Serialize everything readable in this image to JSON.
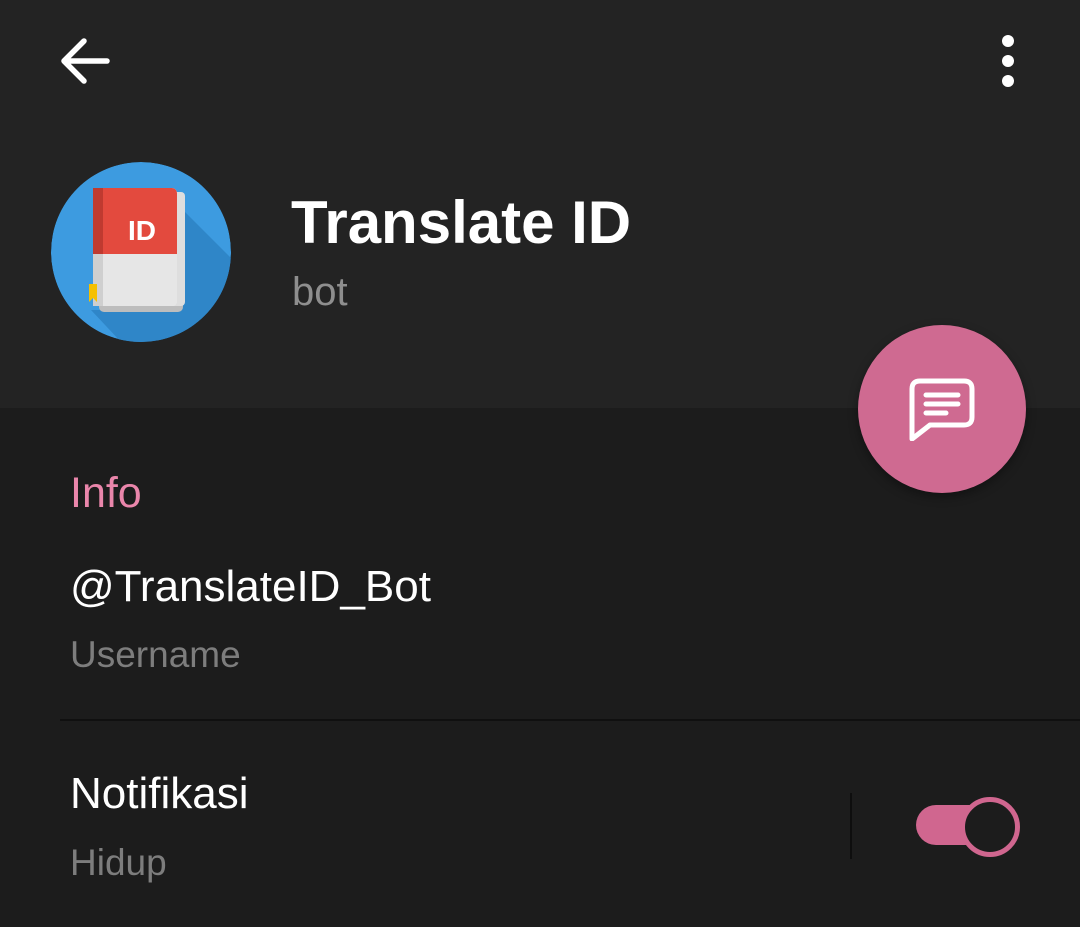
{
  "header": {
    "back_icon": "arrow-left-icon",
    "menu_icon": "more-vertical-icon",
    "title": "Translate ID",
    "subtitle": "bot",
    "avatar_icon": "book-icon",
    "avatar_badge": "ID"
  },
  "fab": {
    "icon": "message-icon"
  },
  "info": {
    "section_title": "Info",
    "username_value": "@TranslateID_Bot",
    "username_label": "Username",
    "notification_label": "Notifikasi",
    "notification_value": "Hidup",
    "notification_enabled": true
  },
  "colors": {
    "accent": "#cf6a91",
    "section_title": "#ea86ab",
    "background": "#1c1c1c",
    "header_background": "#232323",
    "avatar_background": "#3d9be0"
  }
}
